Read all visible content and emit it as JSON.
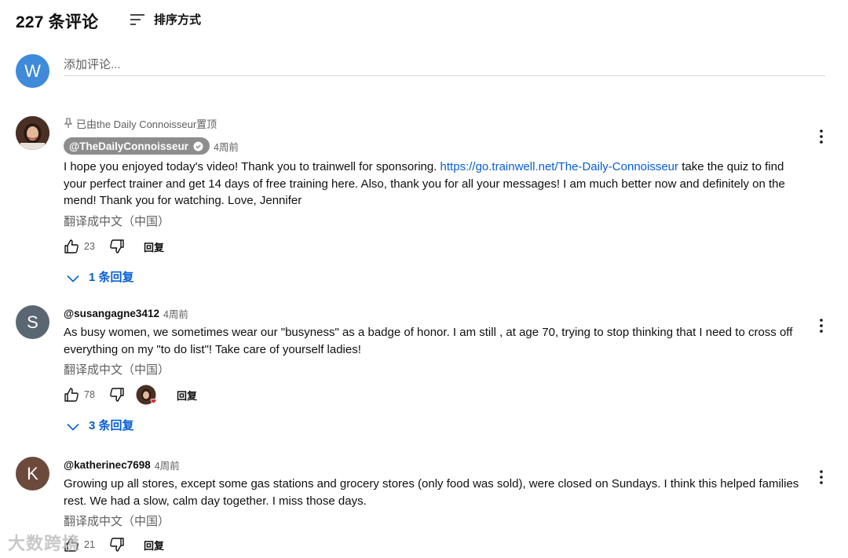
{
  "header": {
    "comment_count_title": "227 条评论",
    "sort_label": "排序方式"
  },
  "add_comment": {
    "avatar_letter": "W",
    "placeholder": "添加评论..."
  },
  "comments": [
    {
      "pinned_text": "已由the Daily Connoisseur置顶",
      "author": "@TheDailyConnoisseur",
      "verified": true,
      "time": "4周前",
      "text_before_link": "I hope you enjoyed today's video! Thank you to trainwell for sponsoring. ",
      "link": "https://go.trainwell.net/The-Daily-Connoisseur",
      "text_after_link": " take the quiz to find your perfect trainer and get 14 days of free training here. Also, thank you for all your messages! I am much better now and definitely on the mend! Thank you for watching. Love, Jennifer",
      "translate": "翻译成中文（中国）",
      "likes": "23",
      "reply_label": "回复",
      "replies_label": "1 条回复"
    },
    {
      "avatar_letter": "S",
      "author": "@susangagne3412",
      "time": "4周前",
      "text": "As busy women, we sometimes wear our \"busyness\" as a badge of honor.  I am still , at age 70, trying to stop thinking that I need to cross off everything on my \"to do list\"!  Take care of yourself ladies!",
      "translate": "翻译成中文（中国）",
      "likes": "78",
      "reply_label": "回复",
      "replies_label": "3 条回复"
    },
    {
      "avatar_letter": "K",
      "author": "@katherinec7698",
      "time": "4周前",
      "text": "Growing up all stores, except some gas stations and grocery stores (only food was sold), were closed on Sundays. I think this helped families rest. We had a slow, calm day together. I miss those days.",
      "translate": "翻译成中文（中国）",
      "likes": "21",
      "reply_label": "回复"
    }
  ],
  "watermark": "大数跨境",
  "colors": {
    "link": "#065fd4",
    "avatar_w": "#3f8ad9",
    "avatar_s": "#5a6773",
    "avatar_k": "#6b4a3c",
    "author_chip": "#8d8d8d",
    "secondary_text": "#606060"
  },
  "icons": [
    "sort-icon",
    "pin-icon",
    "verified-icon",
    "thumbs-up-icon",
    "thumbs-down-icon",
    "more-vert-icon",
    "chevron-down-icon",
    "creator-heart-icon"
  ]
}
